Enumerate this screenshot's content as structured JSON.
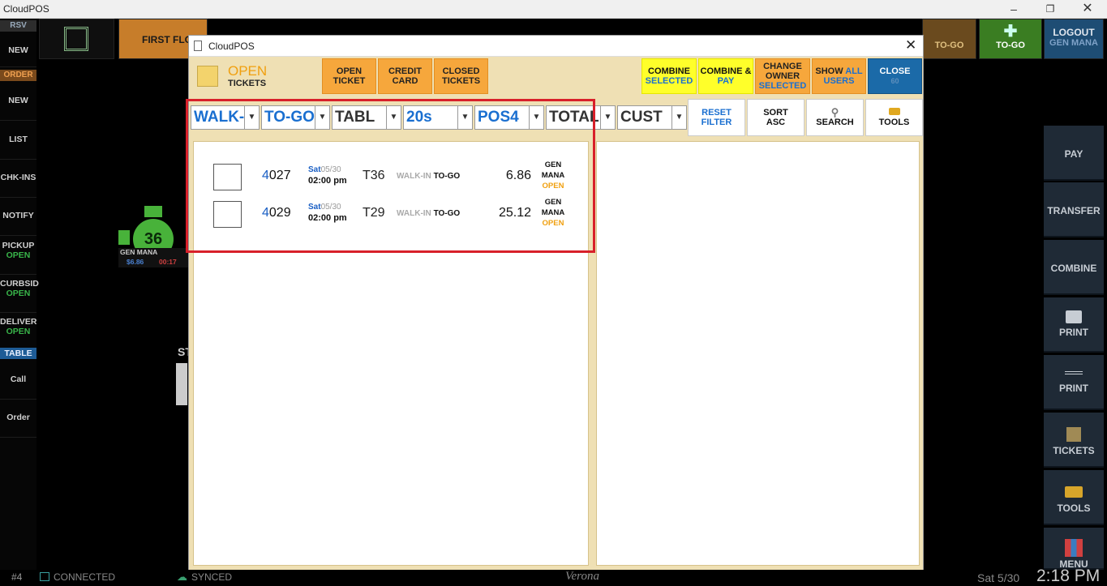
{
  "window": {
    "title": "CloudPOS"
  },
  "left_sidebar": {
    "rsv_header": "RSV",
    "rsv_new": "NEW",
    "order_header": "ORDER",
    "order_new": "NEW",
    "list": "LIST",
    "chkins": "CHK-INS",
    "notify": "NOTIFY",
    "pickup": "PICKUP",
    "pickup_status": "OPEN",
    "curbside": "CURBSID",
    "curbside_status": "OPEN",
    "delivery": "DELIVER",
    "delivery_status": "OPEN",
    "table_header": "TABLE",
    "call": "Call",
    "order": "Order"
  },
  "top_tiles": {
    "first_floor": "FIRST FLO",
    "togo_tab": "TO-GO",
    "togo_add": "TO-GO",
    "logout": "LOGOUT",
    "logout_user": "GEN MANA"
  },
  "table_widget": {
    "number": "36",
    "user": "GEN MANA",
    "amount": "$6.86",
    "timer": "00:17"
  },
  "background_label": "ST",
  "right_sidebar": [
    "PAY",
    "TRANSFER",
    "COMBINE",
    "PRINT",
    "PRINT",
    "TICKETS",
    "TOOLS",
    "MENU"
  ],
  "dialog": {
    "title": "CloudPOS",
    "open_title": "OPEN",
    "open_sub": "TICKETS",
    "btn_open_ticket": [
      "OPEN",
      "TICKET"
    ],
    "btn_credit_card": [
      "CREDIT",
      "CARD"
    ],
    "btn_closed_tickets": [
      "CLOSED",
      "TICKETS"
    ],
    "btn_combine_selected": [
      "COMBINE",
      "SELECTED"
    ],
    "btn_combine_pay": [
      "COMBINE &",
      "PAY"
    ],
    "btn_change_owner": [
      "CHANGE",
      "OWNER",
      "SELECTED"
    ],
    "btn_show_all": [
      "SHOW",
      "ALL",
      "USERS"
    ],
    "btn_close": [
      "CLOSE",
      "60"
    ],
    "filters": [
      {
        "label": "WALK-I",
        "color": "#1a6fd0"
      },
      {
        "label": "TO-GO",
        "color": "#1a6fd0"
      },
      {
        "label": "TABL",
        "color": "#333333"
      },
      {
        "label": "20s",
        "color": "#1a6fd0"
      },
      {
        "label": "POS4",
        "color": "#1a6fd0"
      },
      {
        "label": "TOTAL",
        "color": "#333333"
      },
      {
        "label": "CUST",
        "color": "#333333"
      }
    ],
    "reset_filter": [
      "RESET",
      "FILTER"
    ],
    "sort": [
      "SORT",
      "ASC"
    ],
    "search": "SEARCH",
    "tools": "TOOLS",
    "tickets": [
      {
        "num_hl": "4",
        "num_rest": "027",
        "day": "Sat",
        "date": "05/30",
        "time": "02:00 pm",
        "table": "T36",
        "walk": "WALK-IN",
        "type": "TO-GO",
        "amount": "6.86",
        "owner1": "GEN",
        "owner2": "MANA",
        "status": "OPEN"
      },
      {
        "num_hl": "4",
        "num_rest": "029",
        "day": "Sat",
        "date": "05/30",
        "time": "02:00 pm",
        "table": "T29",
        "walk": "WALK-IN",
        "type": "TO-GO",
        "amount": "25.12",
        "owner1": "GEN",
        "owner2": "MANA",
        "status": "OPEN"
      }
    ]
  },
  "status_bar": {
    "station": "#4",
    "connected": "CONNECTED",
    "synced": "SYNCED",
    "brand": "Verona",
    "date": "Sat 5/30",
    "time": "2:18 PM"
  },
  "colors": {
    "highlight_box": "#d8202a",
    "accent_blue": "#1a6fd0",
    "open_orange": "#f0a010",
    "green": "#39b54a"
  }
}
